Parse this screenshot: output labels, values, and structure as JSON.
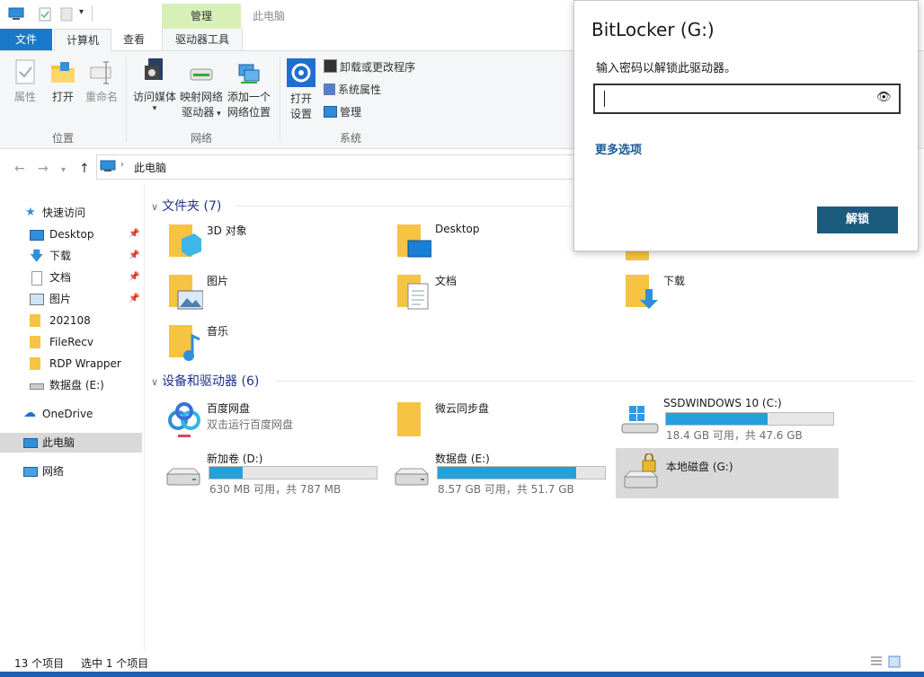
{
  "titlebar": {
    "title": "此电脑",
    "manage_tab": "管理"
  },
  "tabs": {
    "file": "文件",
    "computer": "计算机",
    "view": "查看",
    "drive_tools": "驱动器工具"
  },
  "ribbon": {
    "location": {
      "label": "位置",
      "properties": "属性",
      "open": "打开",
      "rename": "重命名"
    },
    "network": {
      "label": "网络",
      "media": "访问媒体",
      "map_drive_1": "映射网络",
      "map_drive_2": "驱动器",
      "add_location_1": "添加一个",
      "add_location_2": "网络位置"
    },
    "system": {
      "label": "系统",
      "open_settings_1": "打开",
      "open_settings_2": "设置",
      "uninstall": "卸载或更改程序",
      "sys_props": "系统属性",
      "manage": "管理"
    }
  },
  "address": {
    "path": "此电脑"
  },
  "nav": {
    "quick_access": "快速访问",
    "items": [
      {
        "label": "Desktop",
        "pinned": true
      },
      {
        "label": "下载",
        "pinned": true
      },
      {
        "label": "文档",
        "pinned": true
      },
      {
        "label": "图片",
        "pinned": true
      },
      {
        "label": "202108",
        "pinned": false
      },
      {
        "label": "FileRecv",
        "pinned": false
      },
      {
        "label": "RDP Wrapper",
        "pinned": false
      },
      {
        "label": "数据盘 (E:)",
        "pinned": false
      }
    ],
    "onedrive": "OneDrive",
    "this_pc": "此电脑",
    "network": "网络"
  },
  "content": {
    "folders_header": "文件夹 (7)",
    "folders": [
      "3D 对象",
      "Desktop",
      "图片",
      "文档",
      "下载",
      "音乐"
    ],
    "devices_header": "设备和驱动器 (6)",
    "baidu": {
      "name": "百度网盘",
      "sub": "双击运行百度网盘"
    },
    "weiyun": {
      "name": "微云同步盘"
    },
    "drives": [
      {
        "name": "SSDWINDOWS 10 (C:)",
        "info": "18.4 GB 可用，共 47.6 GB",
        "used": 0.61
      },
      {
        "name": "新加卷 (D:)",
        "info": "630 MB 可用，共 787 MB",
        "used": 0.2
      },
      {
        "name": "数据盘 (E:)",
        "info": "8.57 GB 可用，共 51.7 GB",
        "used": 0.83
      },
      {
        "name": "本地磁盘 (G:)"
      }
    ]
  },
  "status": {
    "count": "13 个项目",
    "selected": "选中 1 个项目"
  },
  "bitlocker": {
    "title": "BitLocker (G:)",
    "prompt": "输入密码以解锁此驱动器。",
    "more_options": "更多选项",
    "unlock": "解锁"
  },
  "colors": {
    "accent": "#1979ca",
    "drive_bar": "#26a0da",
    "unlock_button": "#1c5b7e",
    "manage_band": "#d8f0b8"
  }
}
